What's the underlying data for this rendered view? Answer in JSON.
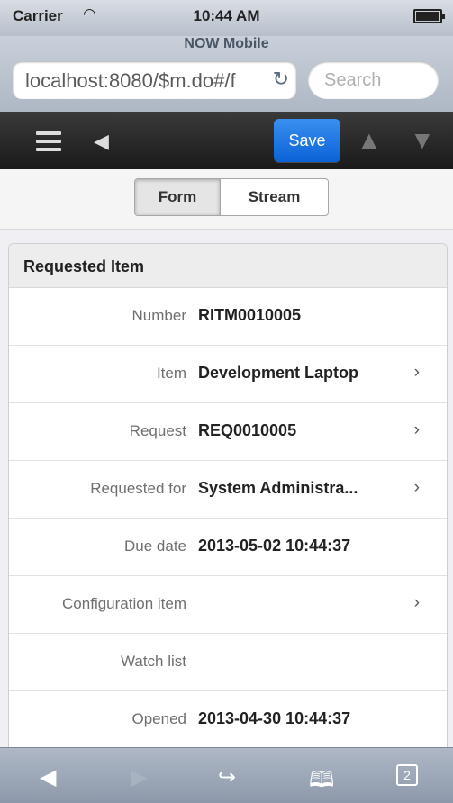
{
  "status_bar": {
    "carrier": "Carrier",
    "time": "10:44 AM",
    "app_title": "NOW Mobile"
  },
  "browser": {
    "url": "localhost:8080/$m.do#/f",
    "search_placeholder": "Search"
  },
  "toolbar": {
    "save_label": "Save"
  },
  "tabs": {
    "form": "Form",
    "stream": "Stream"
  },
  "section": {
    "title": "Requested Item"
  },
  "fields": [
    {
      "label": "Number",
      "value": "RITM0010005"
    },
    {
      "label": "Item",
      "value": "Development Laptop"
    },
    {
      "label": "Request",
      "value": "REQ0010005"
    },
    {
      "label": "Requested for",
      "value": "System Administra..."
    },
    {
      "label": "Due date",
      "value": "2013-05-02 10:44:37"
    },
    {
      "label": "Configuration item",
      "value": ""
    },
    {
      "label": "Watch list",
      "value": ""
    },
    {
      "label": "Opened",
      "value": "2013-04-30 10:44:37"
    }
  ],
  "bottom_bar": {
    "tabs_count": "2"
  },
  "icons": [
    "wifi-icon",
    "battery-icon",
    "reload-icon",
    "menu-icon",
    "back-icon",
    "up-arrow-icon",
    "down-arrow-icon",
    "chevron-right-icon",
    "browser-back-icon",
    "browser-forward-icon",
    "share-icon",
    "bookmarks-icon",
    "tabs-icon"
  ],
  "colors": {
    "save_button": "#0b62d6",
    "app_bar": "#1a1a1a"
  }
}
